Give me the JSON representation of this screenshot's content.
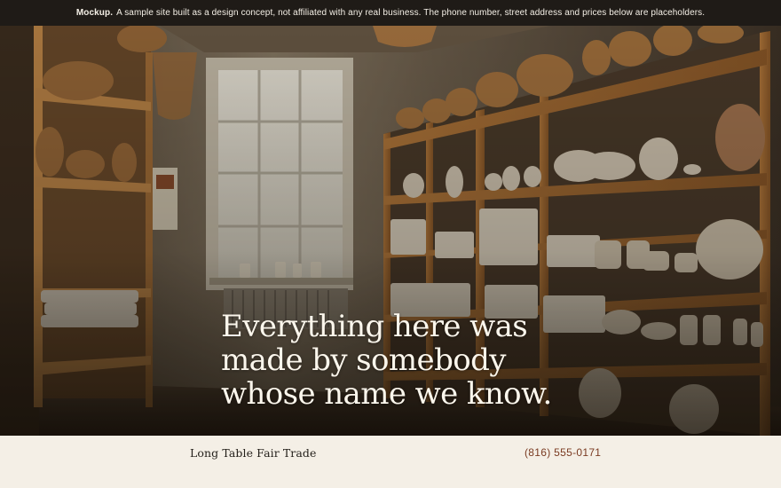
{
  "banner": {
    "label": "Mockup.",
    "text": "A sample site built as a design concept, not affiliated with any real business. The phone number, street address and prices below are placeholders."
  },
  "hero": {
    "headline": "Everything here was made by somebody whose name we know."
  },
  "footer": {
    "brand": "Long Table Fair Trade",
    "phone": "(816) 555-0171"
  },
  "colors": {
    "banner_bg": "#1f1b17",
    "footer_bg": "#f4efe6",
    "phone_accent": "#7a3b22",
    "headline": "#fbf6ec"
  }
}
